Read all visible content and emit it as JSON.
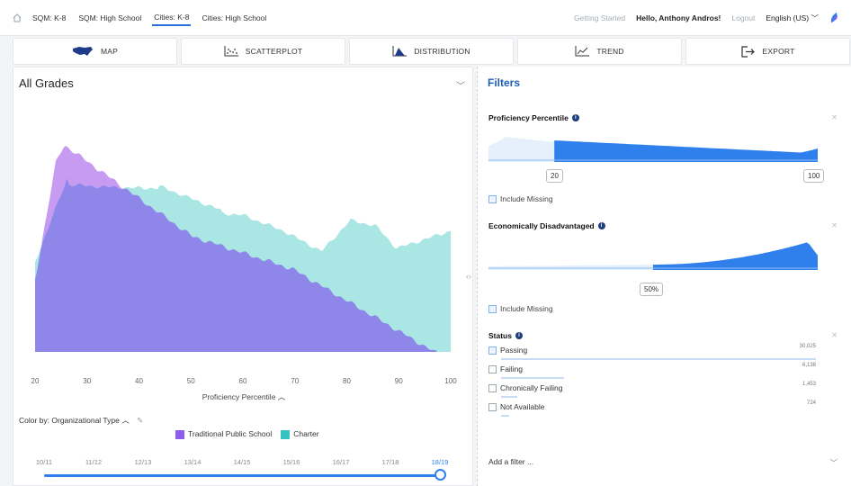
{
  "topbar": {
    "tabs": [
      "SQM: K-8",
      "SQM: High School",
      "Cities: K-8",
      "Cities: High School"
    ],
    "active_tab": 2,
    "getting_started": "Getting Started",
    "greeting": "Hello, Anthony Andros!",
    "logout": "Logout",
    "language": "English (US)"
  },
  "nav": {
    "buttons": [
      {
        "label": "MAP",
        "icon": "us-map-icon"
      },
      {
        "label": "SCATTERPLOT",
        "icon": "scatterplot-icon"
      },
      {
        "label": "DISTRIBUTION",
        "icon": "distribution-icon"
      },
      {
        "label": "TREND",
        "icon": "trend-icon"
      },
      {
        "label": "EXPORT",
        "icon": "export-icon"
      }
    ]
  },
  "left": {
    "grade_select": "All Grades",
    "x_ticks": [
      "20",
      "30",
      "40",
      "50",
      "60",
      "70",
      "80",
      "90",
      "100"
    ],
    "x_label": "Proficiency Percentile",
    "color_by_label": "Color by:",
    "color_by_value": "Organizational Type",
    "legend": [
      {
        "label": "Traditional Public School",
        "color": "#8e5cf0"
      },
      {
        "label": "Charter",
        "color": "#35c2c1"
      }
    ],
    "years": [
      "10/11",
      "11/12",
      "12/13",
      "13/14",
      "14/15",
      "15/16",
      "16/17",
      "17/18",
      "18/19"
    ],
    "selected_year": "18/19"
  },
  "filters": {
    "title": "Filters",
    "proficiency": {
      "title": "Proficiency Percentile",
      "min": "20",
      "max": "100",
      "include_missing": "Include Missing"
    },
    "econ": {
      "title": "Economically Disadvantaged",
      "value": "50%",
      "include_missing": "Include Missing"
    },
    "status": {
      "title": "Status",
      "items": [
        {
          "label": "Passing",
          "count": "30,025",
          "checked": true,
          "level": 1.0
        },
        {
          "label": "Failing",
          "count": "6,138",
          "checked": false,
          "level": 0.2
        },
        {
          "label": "Chronically Failing",
          "count": "1,453",
          "checked": false,
          "level": 0.05
        },
        {
          "label": "Not Available",
          "count": "724",
          "checked": false,
          "level": 0.025
        }
      ]
    },
    "add_filter": "Add a filter ..."
  },
  "colors": {
    "accent": "#2f80ed",
    "tps": "#8e5cf0",
    "charter": "#35c2c1",
    "blend": "#8f86ea"
  }
}
